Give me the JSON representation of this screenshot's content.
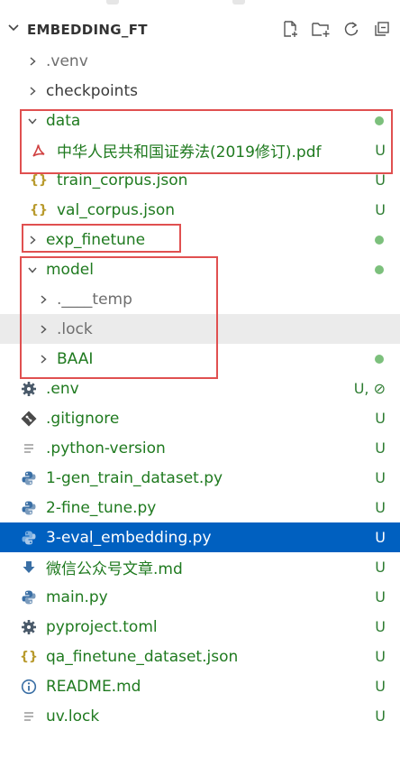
{
  "explorer": {
    "root_label": "EMBEDDING_FT",
    "actions": [
      "new-file-icon",
      "new-folder-icon",
      "refresh-icon",
      "collapse-all-icon"
    ]
  },
  "tree": [
    {
      "label": ".venv",
      "type": "folder",
      "expanded": false,
      "status": ""
    },
    {
      "label": "checkpoints",
      "type": "folder",
      "expanded": false,
      "status": ""
    },
    {
      "label": "data",
      "type": "folder",
      "expanded": true,
      "status": "dot"
    },
    {
      "label": "中华人民共和国证券法(2019修订).pdf",
      "type": "pdf",
      "status": "U"
    },
    {
      "label": "train_corpus.json",
      "type": "json",
      "status": "U"
    },
    {
      "label": "val_corpus.json",
      "type": "json",
      "status": "U"
    },
    {
      "label": "exp_finetune",
      "type": "folder",
      "expanded": false,
      "status": "dot"
    },
    {
      "label": "model",
      "type": "folder",
      "expanded": true,
      "status": "dot"
    },
    {
      "label": ".____temp",
      "type": "folder",
      "expanded": false,
      "status": ""
    },
    {
      "label": ".lock",
      "type": "folder",
      "expanded": false,
      "status": ""
    },
    {
      "label": "BAAI",
      "type": "folder",
      "expanded": false,
      "status": "dot"
    },
    {
      "label": ".env",
      "type": "gear",
      "status": "U, ⊘"
    },
    {
      "label": ".gitignore",
      "type": "git",
      "status": "U"
    },
    {
      "label": ".python-version",
      "type": "text",
      "status": "U"
    },
    {
      "label": "1-gen_train_dataset.py",
      "type": "python",
      "status": "U"
    },
    {
      "label": "2-fine_tune.py",
      "type": "python",
      "status": "U"
    },
    {
      "label": "3-eval_embedding.py",
      "type": "python",
      "status": "U",
      "selected": true
    },
    {
      "label": "微信公众号文章.md",
      "type": "markdown",
      "status": "U"
    },
    {
      "label": "main.py",
      "type": "python",
      "status": "U"
    },
    {
      "label": "pyproject.toml",
      "type": "gear",
      "status": "U"
    },
    {
      "label": "qa_finetune_dataset.json",
      "type": "json",
      "status": "U"
    },
    {
      "label": "README.md",
      "type": "info",
      "status": "U"
    },
    {
      "label": "uv.lock",
      "type": "text",
      "status": "U"
    }
  ],
  "colors": {
    "selected_bg": "#0060c0",
    "untracked_green": "#2e7d32",
    "highlight_red": "#e05050",
    "hover_bg": "#ebebeb"
  }
}
